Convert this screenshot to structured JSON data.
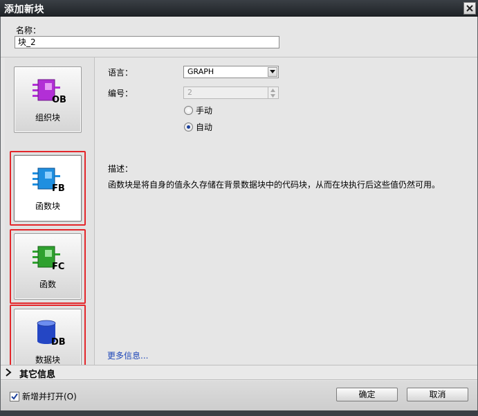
{
  "window": {
    "title": "添加新块"
  },
  "name_field": {
    "label": "名称：",
    "value": "块_2"
  },
  "block_types": [
    {
      "id": "ob",
      "label": "组织块",
      "icon_text": "OB",
      "icon_color": "#b22fd6"
    },
    {
      "id": "fb",
      "label": "函数块",
      "icon_text": "FB",
      "icon_color": "#1f8fe0"
    },
    {
      "id": "fc",
      "label": "函数",
      "icon_text": "FC",
      "icon_color": "#2fa12f"
    },
    {
      "id": "db",
      "label": "数据块",
      "icon_text": "DB",
      "icon_color": "#2446c4"
    }
  ],
  "highlight_color": "#e3262a",
  "settings": {
    "language_label": "语言：",
    "language_value": "GRAPH",
    "number_label": "编号：",
    "number_value": "2",
    "manual_label": "手动",
    "auto_label": "自动",
    "selected_numbering": "自动"
  },
  "description": {
    "label": "描述：",
    "text": "函数块是将自身的值永久存储在背景数据块中的代码块，从而在块执行后这些值仍然可用。"
  },
  "more_info_link": "更多信息...",
  "other_info": {
    "label": "其它信息"
  },
  "footer": {
    "add_and_open_label": "新增并打开(O)",
    "add_and_open_checked": true,
    "ok_label": "确定",
    "cancel_label": "取消"
  }
}
